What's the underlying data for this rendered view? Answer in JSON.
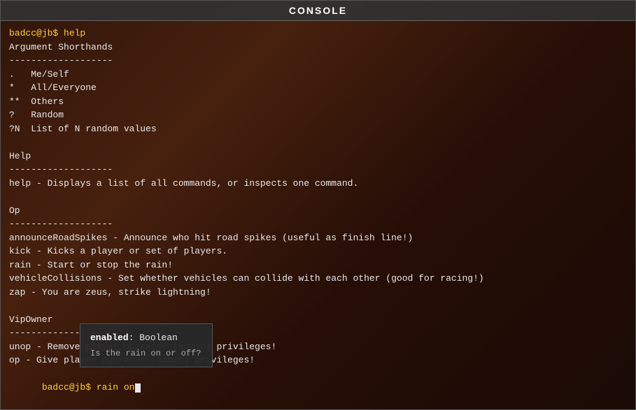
{
  "window": {
    "title": "CONSOLE"
  },
  "console": {
    "lines": [
      {
        "type": "prompt",
        "text": "badcc@jb$ help"
      },
      {
        "type": "normal",
        "text": "Argument Shorthands"
      },
      {
        "type": "normal",
        "text": "-------------------"
      },
      {
        "type": "normal",
        "text": ".   Me/Self"
      },
      {
        "type": "normal",
        "text": "*   All/Everyone"
      },
      {
        "type": "normal",
        "text": "**  Others"
      },
      {
        "type": "normal",
        "text": "?   Random"
      },
      {
        "type": "normal",
        "text": "?N  List of N random values"
      },
      {
        "type": "empty"
      },
      {
        "type": "normal",
        "text": "Help"
      },
      {
        "type": "normal",
        "text": "-------------------"
      },
      {
        "type": "normal",
        "text": "help - Displays a list of all commands, or inspects one command."
      },
      {
        "type": "empty"
      },
      {
        "type": "normal",
        "text": "Op"
      },
      {
        "type": "normal",
        "text": "-------------------"
      },
      {
        "type": "normal",
        "text": "announceRoadSpikes - Announce who hit road spikes (useful as finish line!)"
      },
      {
        "type": "normal",
        "text": "kick - Kicks a player or set of players."
      },
      {
        "type": "normal",
        "text": "rain - Start or stop the rain!"
      },
      {
        "type": "normal",
        "text": "vehicleCollisions - Set whether vehicles can collide with each other (good for racing!)"
      },
      {
        "type": "normal",
        "text": "zap - You are zeus, strike lightning!"
      },
      {
        "type": "empty"
      },
      {
        "type": "normal",
        "text": "VipOwner"
      },
      {
        "type": "normal",
        "text": "-------------------"
      },
      {
        "type": "normal",
        "text": "unop - Remove player operator (admin) privileges!"
      },
      {
        "type": "normal",
        "text": "op - Give player operator (admin) privileges!"
      },
      {
        "type": "prompt",
        "text": "badcc@jb$ rain on"
      }
    ],
    "prompt_prefix": "badcc@jb$ "
  },
  "tooltip": {
    "param_name": "enabled",
    "param_separator": ": ",
    "param_type": "Boolean",
    "description": "Is the rain on or off?"
  }
}
